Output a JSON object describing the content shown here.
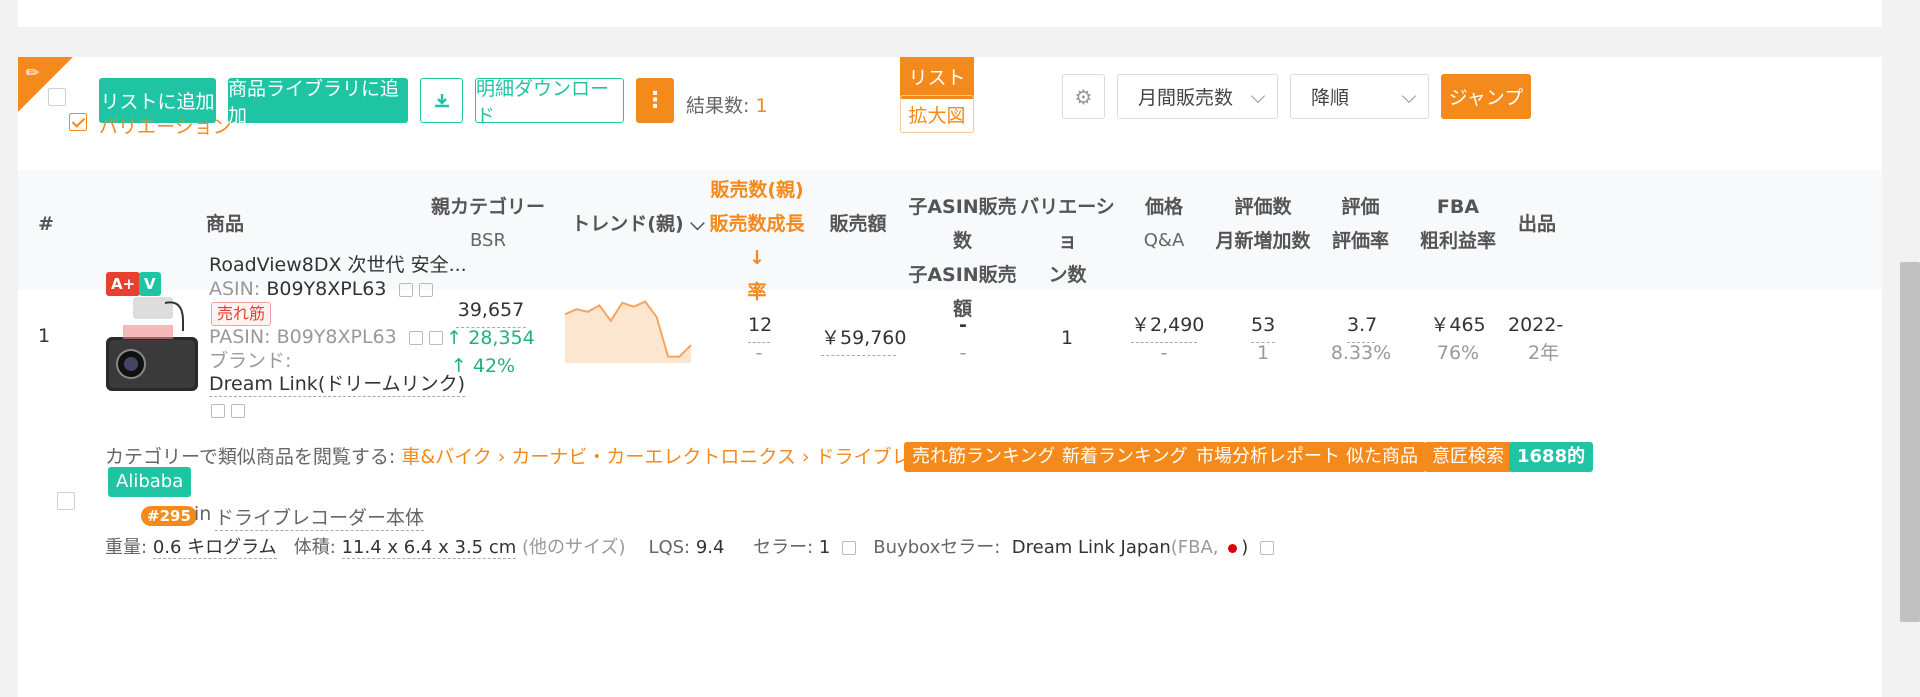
{
  "toolbar": {
    "add_to_list": "リストに追加",
    "add_to_library": "商品ライブラリに追加",
    "download_detail": "明細ダウンロード",
    "result_label": "結果数:",
    "result_count": "1",
    "variation_label": "バリエーション",
    "view_list": "リスト",
    "view_zoom": "拡大図",
    "sort_field": "月間販売数",
    "sort_order": "降順",
    "jump": "ジャンプ"
  },
  "columns": {
    "index": "#",
    "product": "商品",
    "bsr_l1": "親カテゴリー",
    "bsr_l2": "BSR",
    "trend": "トレンド(親)",
    "sales_l1": "販売数(親)",
    "sales_l2": "販売数成長↓",
    "sales_l3": "率",
    "revenue": "販売額",
    "child_l1": "子ASIN販売数",
    "child_l2": "子ASIN販売額",
    "var_l1": "バリエーショ",
    "var_l2": "ン数",
    "price_l1": "価格",
    "price_l2": "Q&A",
    "reviews_l1": "評価数",
    "reviews_l2": "月新増加数",
    "rating_l1": "評価",
    "rating_l2": "評価率",
    "fba_l1": "FBA",
    "fba_l2": "粗利益率",
    "listed": "出品"
  },
  "row": {
    "index": "1",
    "badge_aplus": "A+",
    "badge_v": "V",
    "title": "RoadView8DX 次世代 安全...",
    "asin_label": "ASIN:",
    "asin": "B09Y8XPL63",
    "bestseller": "売れ筋",
    "pasin_label": "PASIN:",
    "pasin": "B09Y8XPL63",
    "brand_label": "ブランド:",
    "brand": "Dream Link(ドリームリンク)",
    "bsr": "39,657",
    "bsr_change": "↑ 28,354",
    "bsr_pct": "↑ 42%",
    "sales": "12",
    "sales_growth": "-",
    "revenue": "￥59,760",
    "child_sales": "-",
    "child_revenue": "-",
    "variations": "1",
    "price": "￥2,490",
    "qa": "-",
    "reviews": "53",
    "reviews_new": "1",
    "rating": "3.7",
    "rating_rate": "8.33%",
    "fba": "￥465",
    "margin": "76%",
    "listed_date": "2022-",
    "listed_age": "2年"
  },
  "trend_values": [
    38,
    42,
    40,
    45,
    33,
    47,
    44,
    48,
    36,
    5,
    5,
    14
  ],
  "category": {
    "prefix": "カテゴリーで類似商品を閲覧する:",
    "path": "車&バイク › カーナビ・カーエレクトロニクス › ドライブレコーダー本体",
    "tags": [
      "売れ筋ランキング",
      "新着ランキング",
      "市場分析レポート",
      "似た商品",
      "意匠検索"
    ],
    "tag_1688": "1688的",
    "tag_alibaba": "Alibaba"
  },
  "rank": {
    "value": "#295",
    "in": "in",
    "category": "ドライブレコーダー本体"
  },
  "specs": {
    "weight_label": "重量:",
    "weight": "0.6 キログラム",
    "volume_label": "体積:",
    "volume": "11.4 x 6.4 x 3.5 cm",
    "other_sizes": "(他のサイズ)",
    "lqs_label": "LQS:",
    "lqs": "9.4",
    "seller_label": "セラー:",
    "seller_count": "1",
    "buybox_label": "Buyboxセラー:",
    "buybox_seller": "Dream Link Japan",
    "buybox_fba": "(FBA,",
    "buybox_close": ")"
  },
  "colors": {
    "accent": "#f48a1c",
    "green": "#1ec4a4",
    "up": "#22b07d"
  }
}
